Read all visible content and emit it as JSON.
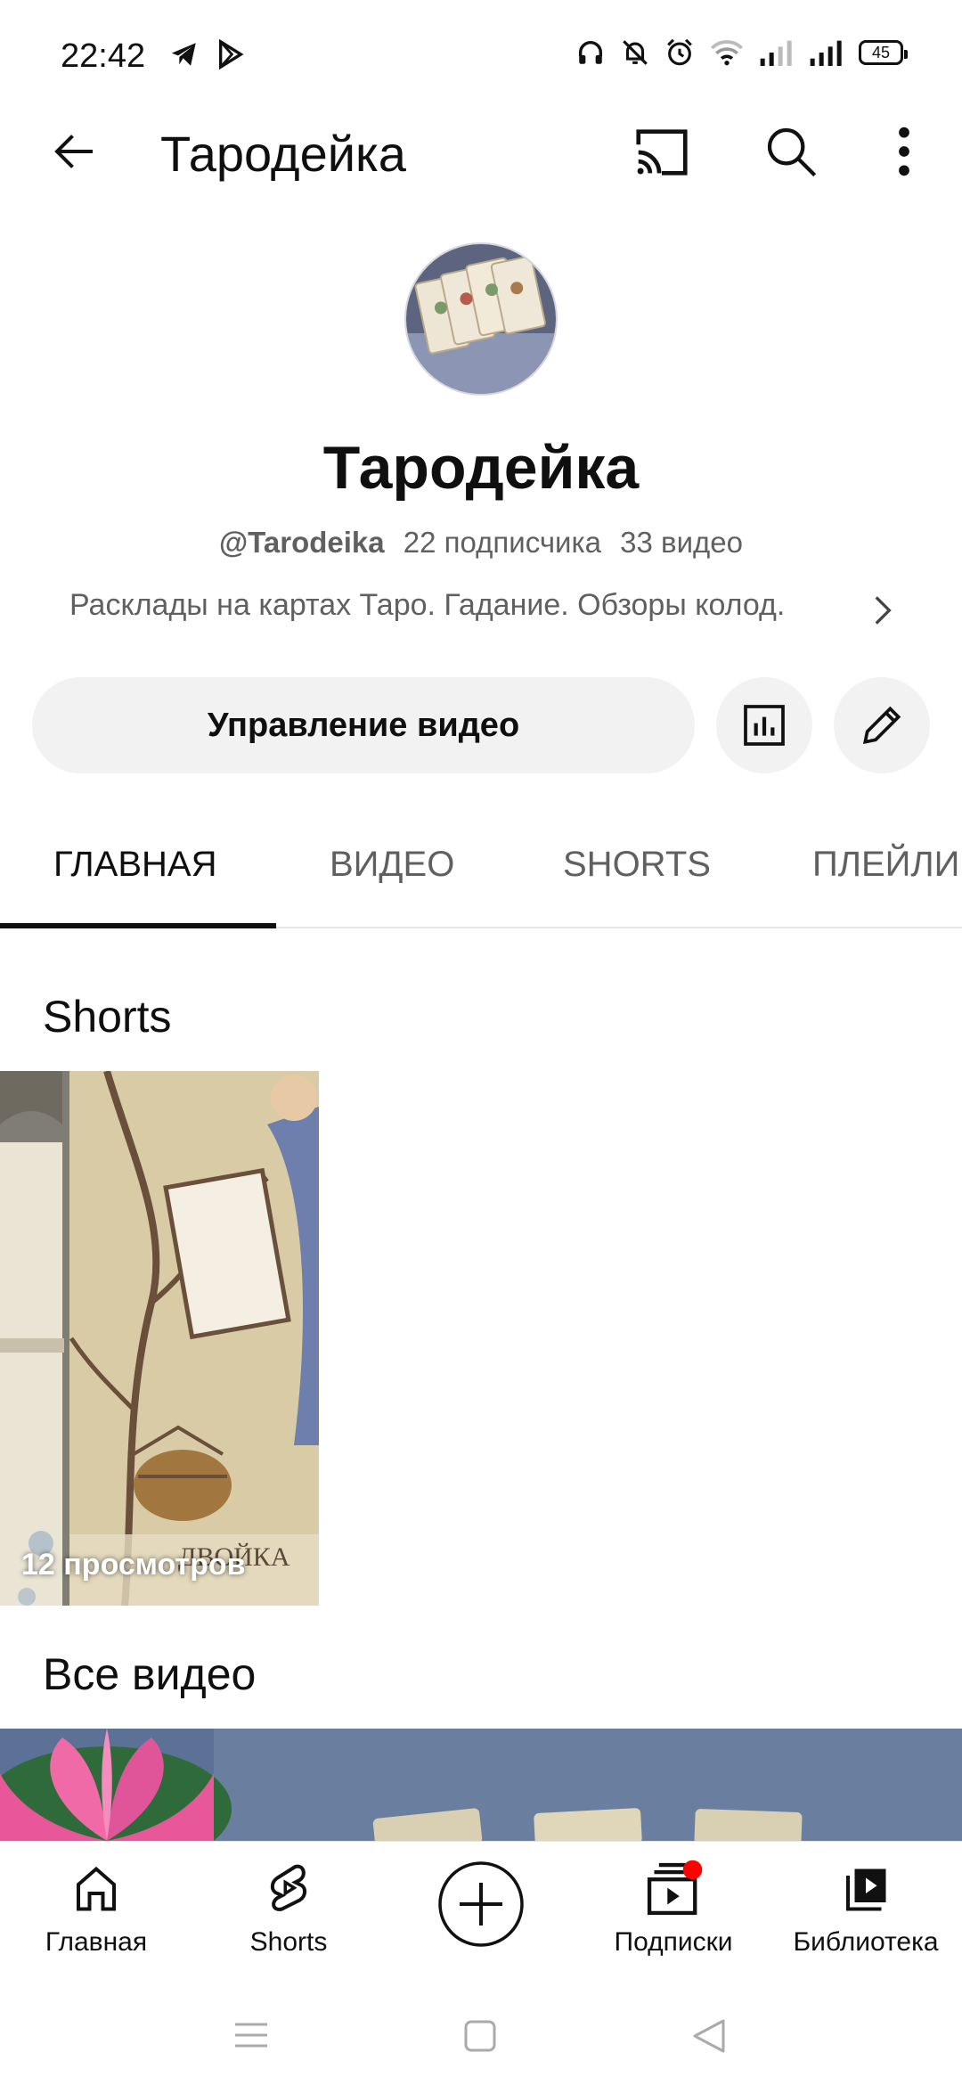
{
  "status_bar": {
    "time": "22:42",
    "battery": "45",
    "left_icons": [
      "telegram-icon",
      "play-store-icon"
    ],
    "right_icons": [
      "headphones-icon",
      "bell-off-icon",
      "alarm-icon",
      "wifi-icon",
      "signal-icon",
      "signal-icon"
    ]
  },
  "app_bar": {
    "title": "Тародейка",
    "icons": [
      "back-arrow-icon",
      "cast-icon",
      "search-icon",
      "more-vert-icon"
    ]
  },
  "channel": {
    "name": "Тародейка",
    "handle": "@Tarodeika",
    "subscribers": "22 подписчика",
    "videos": "33 видео",
    "description": "Расклады на картах Таро. Гадание. Обзоры колод."
  },
  "actions": {
    "manage_label": "Управление видео",
    "stats_icon": "analytics-icon",
    "edit_icon": "pencil-icon"
  },
  "tabs": [
    {
      "label": "ГЛАВНАЯ",
      "active": true
    },
    {
      "label": "ВИДЕО",
      "active": false
    },
    {
      "label": "SHORTS",
      "active": false
    },
    {
      "label": "ПЛЕЙЛИ",
      "active": false
    }
  ],
  "shorts_section": {
    "title": "Shorts",
    "items": [
      {
        "views": "12 просмотров",
        "overlay_text": "ДВОЙКА"
      }
    ]
  },
  "all_videos_section": {
    "title": "Все видео"
  },
  "bottom_nav": [
    {
      "label": "Главная",
      "icon": "home-icon"
    },
    {
      "label": "Shorts",
      "icon": "shorts-icon"
    },
    {
      "label": "",
      "icon": "create-icon"
    },
    {
      "label": "Подписки",
      "icon": "subscriptions-icon",
      "badge": true
    },
    {
      "label": "Библиотека",
      "icon": "library-icon"
    }
  ],
  "colors": {
    "text_primary": "#0f0f0f",
    "text_secondary": "#606060",
    "chip_bg": "#f2f2f2",
    "badge_red": "#ff0000"
  }
}
